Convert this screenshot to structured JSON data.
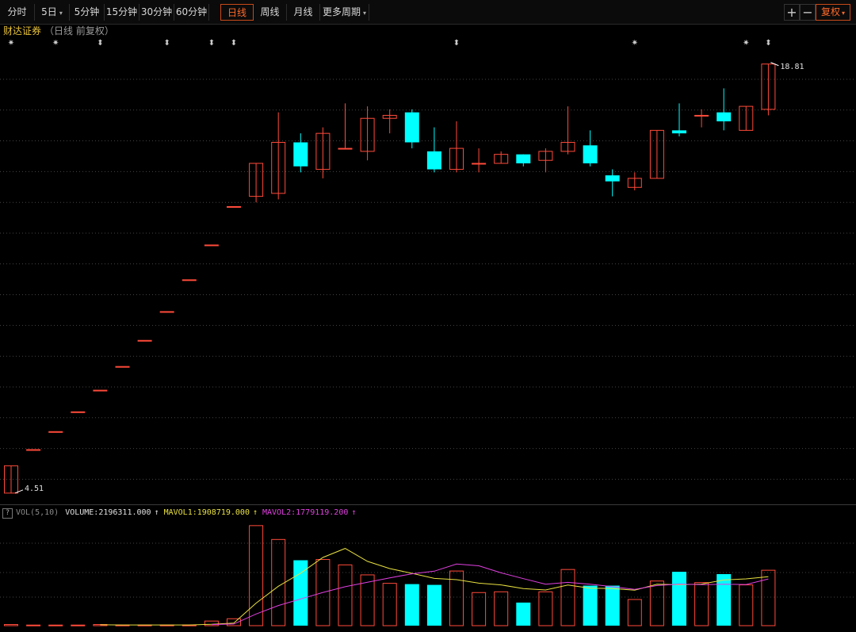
{
  "toolbar": {
    "tabs": [
      {
        "label": "分时",
        "caret": false,
        "active": false,
        "name": "tab-fenshi"
      },
      {
        "label": "5日",
        "caret": true,
        "active": false,
        "name": "tab-5day"
      },
      {
        "label": "5分钟",
        "caret": false,
        "active": false,
        "name": "tab-5min"
      },
      {
        "label": "15分钟",
        "caret": false,
        "active": false,
        "name": "tab-15min"
      },
      {
        "label": "30分钟",
        "caret": false,
        "active": false,
        "name": "tab-30min"
      },
      {
        "label": "60分钟",
        "caret": false,
        "active": false,
        "name": "tab-60min"
      },
      {
        "label": "日线",
        "caret": false,
        "active": true,
        "name": "tab-daily"
      },
      {
        "label": "周线",
        "caret": false,
        "active": false,
        "name": "tab-weekly"
      },
      {
        "label": "月线",
        "caret": false,
        "active": false,
        "name": "tab-monthly"
      },
      {
        "label": "更多周期",
        "caret": true,
        "active": false,
        "name": "tab-more-periods"
      }
    ],
    "zoom_in": "+",
    "zoom_out": "−",
    "fuquan_label": "复权",
    "caret": "▾"
  },
  "stock": {
    "name": "财达证券",
    "subtitle": "（日线 前复权）"
  },
  "volume_legend": {
    "help": "?",
    "indicator": "VOL(5,10)",
    "volume": "VOLUME:2196311.000",
    "mavol1": "MAVOL1:1908719.000",
    "mavol2": "MAVOL2:1779119.200",
    "arrow": "↑"
  },
  "colors": {
    "up": "#ff4a3a",
    "down": "#00ffff",
    "mavol1": "#e8e040",
    "mavol2": "#e040e0",
    "grid": "#444444"
  },
  "chart_data": {
    "type": "candlestick",
    "price_annotations": {
      "high_label": "18.81",
      "low_label": "4.51"
    },
    "ylim": [
      4.4,
      19.2
    ],
    "candles": [
      {
        "o": 4.51,
        "h": 5.42,
        "l": 4.51,
        "c": 5.42
      },
      {
        "o": 5.96,
        "h": 5.96,
        "l": 5.96,
        "c": 5.96
      },
      {
        "o": 6.56,
        "h": 6.56,
        "l": 6.56,
        "c": 6.56
      },
      {
        "o": 7.22,
        "h": 7.22,
        "l": 7.22,
        "c": 7.22
      },
      {
        "o": 7.94,
        "h": 7.94,
        "l": 7.94,
        "c": 7.94
      },
      {
        "o": 8.73,
        "h": 8.73,
        "l": 8.73,
        "c": 8.73
      },
      {
        "o": 9.6,
        "h": 9.6,
        "l": 9.6,
        "c": 9.6
      },
      {
        "o": 10.56,
        "h": 10.56,
        "l": 10.56,
        "c": 10.56
      },
      {
        "o": 11.62,
        "h": 11.62,
        "l": 11.62,
        "c": 11.62
      },
      {
        "o": 12.78,
        "h": 12.78,
        "l": 12.78,
        "c": 12.78
      },
      {
        "o": 14.06,
        "h": 14.06,
        "l": 14.06,
        "c": 14.06
      },
      {
        "o": 14.4,
        "h": 15.5,
        "l": 14.2,
        "c": 15.5
      },
      {
        "o": 14.5,
        "h": 17.2,
        "l": 14.3,
        "c": 16.2
      },
      {
        "o": 16.2,
        "h": 16.5,
        "l": 15.2,
        "c": 15.4
      },
      {
        "o": 15.3,
        "h": 16.7,
        "l": 15.0,
        "c": 16.5
      },
      {
        "o": 16.0,
        "h": 17.5,
        "l": 16.0,
        "c": 16.0
      },
      {
        "o": 15.9,
        "h": 17.4,
        "l": 15.6,
        "c": 17.0
      },
      {
        "o": 17.0,
        "h": 17.3,
        "l": 16.5,
        "c": 17.1
      },
      {
        "o": 17.2,
        "h": 17.3,
        "l": 16.0,
        "c": 16.2
      },
      {
        "o": 15.9,
        "h": 16.7,
        "l": 15.2,
        "c": 15.3
      },
      {
        "o": 15.3,
        "h": 16.9,
        "l": 15.2,
        "c": 16.0
      },
      {
        "o": 15.5,
        "h": 16.0,
        "l": 15.2,
        "c": 15.5
      },
      {
        "o": 15.5,
        "h": 15.9,
        "l": 15.5,
        "c": 15.8
      },
      {
        "o": 15.8,
        "h": 15.8,
        "l": 15.4,
        "c": 15.5
      },
      {
        "o": 15.6,
        "h": 16.0,
        "l": 15.2,
        "c": 15.9
      },
      {
        "o": 15.9,
        "h": 17.4,
        "l": 15.8,
        "c": 16.2
      },
      {
        "o": 16.1,
        "h": 16.6,
        "l": 15.4,
        "c": 15.5
      },
      {
        "o": 15.1,
        "h": 15.3,
        "l": 14.4,
        "c": 14.9
      },
      {
        "o": 14.7,
        "h": 15.2,
        "l": 14.6,
        "c": 15.0
      },
      {
        "o": 15.0,
        "h": 16.6,
        "l": 15.0,
        "c": 16.6
      },
      {
        "o": 16.6,
        "h": 17.5,
        "l": 16.4,
        "c": 16.5
      },
      {
        "o": 17.1,
        "h": 17.3,
        "l": 16.7,
        "c": 17.1
      },
      {
        "o": 17.2,
        "h": 18.0,
        "l": 16.6,
        "c": 16.9
      },
      {
        "o": 16.6,
        "h": 17.4,
        "l": 16.6,
        "c": 17.4
      },
      {
        "o": 17.3,
        "h": 18.81,
        "l": 17.1,
        "c": 18.81
      }
    ],
    "volume": {
      "ylim": [
        0,
        135
      ],
      "values": [
        1.5,
        0.8,
        0.8,
        0.8,
        1.5,
        0.8,
        0.8,
        0.8,
        0.8,
        6,
        9,
        130,
        112,
        85,
        86,
        79,
        66,
        55,
        54,
        53,
        71,
        43,
        44,
        30,
        44,
        73,
        52,
        52,
        34,
        58,
        70,
        56,
        67,
        53,
        72
      ],
      "mavol1": [
        null,
        null,
        null,
        null,
        1.1,
        0.9,
        0.9,
        0.9,
        0.9,
        1.8,
        3.4,
        29.3,
        51.2,
        68.2,
        88.6,
        100.4,
        83.6,
        74.2,
        68.0,
        61.4,
        59.8,
        55.2,
        53.0,
        48.2,
        46.4,
        52.8,
        48.6,
        48.2,
        46.2,
        53.8,
        53.2,
        54.0,
        59.4,
        60.8,
        63.6
      ],
      "mavol2": [
        null,
        null,
        null,
        null,
        null,
        null,
        null,
        null,
        null,
        1.4,
        2.2,
        15.1,
        26.2,
        34.6,
        43.2,
        50.6,
        56.5,
        62.1,
        67.4,
        70.8,
        80.1,
        77.8,
        68.6,
        61.1,
        53.9,
        56.3,
        53.9,
        50.6,
        47.2,
        52.1,
        54.0,
        53.3,
        53.8,
        53.5,
        60.7
      ]
    },
    "markers": [
      {
        "index": 0,
        "glyph": "✷"
      },
      {
        "index": 2,
        "glyph": "✷"
      },
      {
        "index": 4,
        "glyph": "⬍"
      },
      {
        "index": 7,
        "glyph": "⬍"
      },
      {
        "index": 9,
        "glyph": "⬍"
      },
      {
        "index": 10,
        "glyph": "⬍"
      },
      {
        "index": 20,
        "glyph": "⬍"
      },
      {
        "index": 28,
        "glyph": "✷"
      },
      {
        "index": 33,
        "glyph": "✷"
      },
      {
        "index": 34,
        "glyph": "⬍"
      }
    ]
  }
}
